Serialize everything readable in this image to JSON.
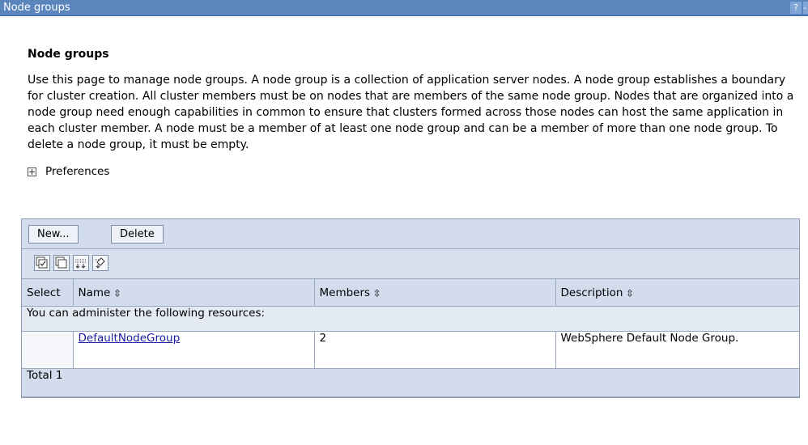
{
  "window": {
    "title": "Node groups",
    "help": "?",
    "minimize": "-"
  },
  "page": {
    "heading": "Node groups",
    "description": "Use this page to manage node groups. A node group is a collection of application server nodes. A node group establishes a boundary for cluster creation. All cluster members must be on nodes that are members of the same node group. Nodes that are organized into a node group need enough capabilities in common to ensure that clusters formed across those nodes can host the same application in each cluster member. A node must be a member of at least one node group and can be a member of more than one node group. To delete a node group, it must be empty.",
    "preferences_label": "Preferences"
  },
  "toolbar": {
    "new_label": "New...",
    "delete_label": "Delete"
  },
  "icon_toolbar": [
    "select-all-icon",
    "deselect-all-icon",
    "show-filter-icon",
    "clear-filter-icon"
  ],
  "table": {
    "columns": [
      "Select",
      "Name",
      "Members",
      "Description"
    ],
    "section_label": "You can administer the following resources:",
    "rows": [
      {
        "name": "DefaultNodeGroup",
        "members": "2",
        "description": "WebSphere Default Node Group."
      }
    ],
    "total_label": "Total 1"
  },
  "colors": {
    "titlebar": "#5b86bd",
    "panel": "#d3dced",
    "link": "#1a1aa6"
  }
}
